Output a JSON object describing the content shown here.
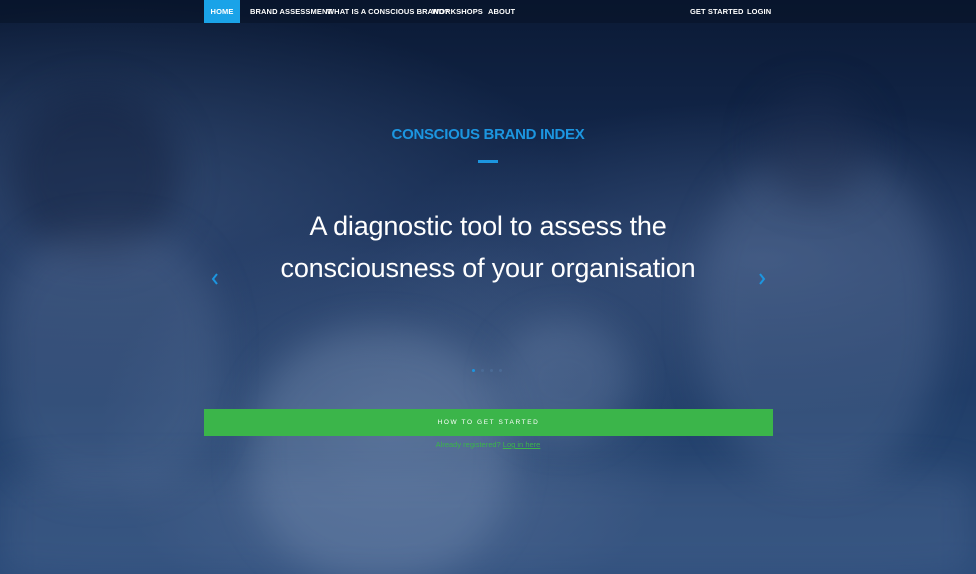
{
  "nav": {
    "items": [
      {
        "label": "HOME",
        "active": true
      },
      {
        "label": "BRAND ASSESSMENT"
      },
      {
        "label": "WHAT IS A CONSCIOUS BRAND?"
      },
      {
        "label": "WORKSHOPS"
      },
      {
        "label": "ABOUT"
      }
    ],
    "right": [
      {
        "label": "GET STARTED"
      },
      {
        "label": "LOGIN"
      }
    ]
  },
  "hero": {
    "eyebrow": "CONSCIOUS BRAND INDEX",
    "headline_line1": "A diagnostic tool to assess the",
    "headline_line2": "consciousness of your organisation",
    "slides": {
      "count": 4,
      "active_index": 0
    },
    "prev_icon": "chevron-left-icon",
    "next_icon": "chevron-right-icon"
  },
  "cta": {
    "label": "HOW TO GET STARTED"
  },
  "login_prompt": {
    "text": "Already registered? ",
    "link": "Log in here"
  },
  "colors": {
    "accent_blue": "#1c96e0",
    "nav_active": "#1aa3e8",
    "cta_green": "#3bb54a",
    "background": "#14284c"
  }
}
